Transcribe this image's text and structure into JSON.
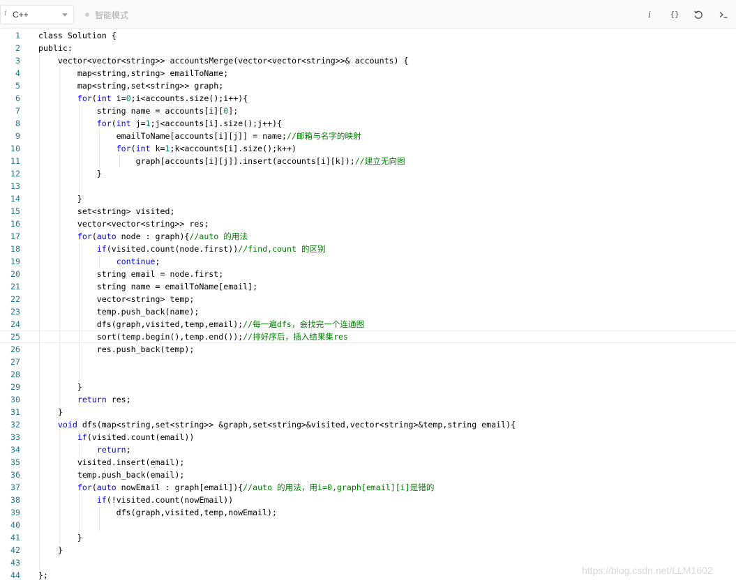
{
  "toolbar": {
    "language_icon": "i",
    "language": "C++",
    "smart_mode": "智能模式",
    "info_button": "i",
    "format_button": "{}",
    "reset_icon": "undo-icon",
    "console_icon": "terminal-icon"
  },
  "editor": {
    "current_line": 25,
    "colors": {
      "keyword": "#0000ff",
      "number": "#098658",
      "comment": "#008000",
      "line_number": "#237893",
      "text": "#000000"
    },
    "lines": [
      {
        "n": "1",
        "t": [
          [
            "class Solution {",
            ""
          ]
        ]
      },
      {
        "n": "2",
        "t": [
          [
            "public",
            ""
          ],
          [
            ":",
            ""
          ]
        ]
      },
      {
        "n": "3",
        "t": [
          [
            "    vector<vector<string>> accountsMerge(vector<vector<string>>& accounts) {",
            ""
          ]
        ]
      },
      {
        "n": "4",
        "t": [
          [
            "        map<string,string> emailToName;",
            ""
          ]
        ]
      },
      {
        "n": "5",
        "t": [
          [
            "        map<string,set<string>> graph;",
            ""
          ]
        ]
      },
      {
        "n": "6",
        "t": [
          [
            "        ",
            ""
          ],
          [
            "for",
            "k"
          ],
          [
            "(",
            ""
          ],
          [
            "int",
            "k"
          ],
          [
            " i=",
            ""
          ],
          [
            "0",
            "n"
          ],
          [
            ";i<accounts.size();i++){",
            ""
          ]
        ]
      },
      {
        "n": "7",
        "t": [
          [
            "            string name = accounts[i][",
            ""
          ],
          [
            "0",
            "n"
          ],
          [
            "];",
            ""
          ]
        ]
      },
      {
        "n": "8",
        "t": [
          [
            "            ",
            ""
          ],
          [
            "for",
            "k"
          ],
          [
            "(",
            ""
          ],
          [
            "int",
            "k"
          ],
          [
            " j=",
            ""
          ],
          [
            "1",
            "n"
          ],
          [
            ";j<accounts[i].size();j++){",
            ""
          ]
        ]
      },
      {
        "n": "9",
        "t": [
          [
            "                emailToName[accounts[i][j]] = name;",
            ""
          ],
          [
            "//邮箱与名字的映射",
            "c"
          ]
        ]
      },
      {
        "n": "10",
        "t": [
          [
            "                ",
            ""
          ],
          [
            "for",
            "k"
          ],
          [
            "(",
            ""
          ],
          [
            "int",
            "k"
          ],
          [
            " k=",
            ""
          ],
          [
            "1",
            "n"
          ],
          [
            ";k<accounts[i].size();k++)",
            ""
          ]
        ]
      },
      {
        "n": "11",
        "t": [
          [
            "                    graph[accounts[i][j]].insert(accounts[i][k]);",
            ""
          ],
          [
            "//建立无向图",
            "c"
          ]
        ]
      },
      {
        "n": "12",
        "t": [
          [
            "            }",
            ""
          ]
        ]
      },
      {
        "n": "13",
        "t": [
          [
            "",
            ""
          ]
        ]
      },
      {
        "n": "14",
        "t": [
          [
            "        }",
            ""
          ]
        ]
      },
      {
        "n": "15",
        "t": [
          [
            "        set<string> visited;",
            ""
          ]
        ]
      },
      {
        "n": "16",
        "t": [
          [
            "        vector<vector<string>> res;",
            ""
          ]
        ]
      },
      {
        "n": "17",
        "t": [
          [
            "        ",
            ""
          ],
          [
            "for",
            "k"
          ],
          [
            "(",
            ""
          ],
          [
            "auto",
            "k"
          ],
          [
            " node : graph){",
            ""
          ],
          [
            "//auto 的用法",
            "c"
          ]
        ]
      },
      {
        "n": "18",
        "t": [
          [
            "            ",
            ""
          ],
          [
            "if",
            "k"
          ],
          [
            "(visited.count(node.first))",
            ""
          ],
          [
            "//find,count 的区别",
            "c"
          ]
        ]
      },
      {
        "n": "19",
        "t": [
          [
            "                ",
            ""
          ],
          [
            "continue",
            "k"
          ],
          [
            ";",
            ""
          ]
        ]
      },
      {
        "n": "20",
        "t": [
          [
            "            string email = node.first;",
            ""
          ]
        ]
      },
      {
        "n": "21",
        "t": [
          [
            "            string name = emailToName[email];",
            ""
          ]
        ]
      },
      {
        "n": "22",
        "t": [
          [
            "            vector<string> temp;",
            ""
          ]
        ]
      },
      {
        "n": "23",
        "t": [
          [
            "            temp.push_back(name);",
            ""
          ]
        ]
      },
      {
        "n": "24",
        "t": [
          [
            "            dfs(graph,visited,temp,email);",
            ""
          ],
          [
            "//每一遍dfs，会找完一个连通图",
            "c"
          ]
        ]
      },
      {
        "n": "25",
        "t": [
          [
            "            sort(temp.begin(),temp.end());",
            ""
          ],
          [
            "//排好序后，插入结果集res",
            "c"
          ]
        ]
      },
      {
        "n": "26",
        "t": [
          [
            "            res.push_back(temp);",
            ""
          ]
        ]
      },
      {
        "n": "27",
        "t": [
          [
            "",
            ""
          ]
        ]
      },
      {
        "n": "28",
        "t": [
          [
            "",
            ""
          ]
        ]
      },
      {
        "n": "29",
        "t": [
          [
            "        }",
            ""
          ]
        ]
      },
      {
        "n": "30",
        "t": [
          [
            "        ",
            ""
          ],
          [
            "return",
            "k"
          ],
          [
            " res;",
            ""
          ]
        ]
      },
      {
        "n": "31",
        "t": [
          [
            "    }",
            ""
          ]
        ]
      },
      {
        "n": "32",
        "t": [
          [
            "    ",
            ""
          ],
          [
            "void",
            "k"
          ],
          [
            " dfs(map<string,set<string>> &graph,set<string>&visited,vector<string>&temp,string email){",
            ""
          ]
        ]
      },
      {
        "n": "33",
        "t": [
          [
            "        ",
            ""
          ],
          [
            "if",
            "k"
          ],
          [
            "(visited.count(email))",
            ""
          ]
        ]
      },
      {
        "n": "34",
        "t": [
          [
            "            ",
            ""
          ],
          [
            "return",
            "k"
          ],
          [
            ";",
            ""
          ]
        ]
      },
      {
        "n": "35",
        "t": [
          [
            "        visited.insert(email);",
            ""
          ]
        ]
      },
      {
        "n": "36",
        "t": [
          [
            "        temp.push_back(email);",
            ""
          ]
        ]
      },
      {
        "n": "37",
        "t": [
          [
            "        ",
            ""
          ],
          [
            "for",
            "k"
          ],
          [
            "(",
            ""
          ],
          [
            "auto",
            "k"
          ],
          [
            " nowEmail : graph[email]){",
            ""
          ],
          [
            "//auto 的用法，用i=0,graph[email][i]是错的",
            "c"
          ]
        ]
      },
      {
        "n": "38",
        "t": [
          [
            "            ",
            ""
          ],
          [
            "if",
            "k"
          ],
          [
            "(!visited.count(nowEmail))",
            ""
          ]
        ]
      },
      {
        "n": "39",
        "t": [
          [
            "                dfs(graph,visited,temp,nowEmail);",
            ""
          ]
        ]
      },
      {
        "n": "40",
        "t": [
          [
            "",
            ""
          ]
        ]
      },
      {
        "n": "41",
        "t": [
          [
            "        }",
            ""
          ]
        ]
      },
      {
        "n": "42",
        "t": [
          [
            "    }",
            ""
          ]
        ]
      },
      {
        "n": "43",
        "t": [
          [
            "",
            ""
          ]
        ]
      },
      {
        "n": "44",
        "t": [
          [
            "};",
            ""
          ]
        ]
      }
    ]
  },
  "watermark": "https://blog.csdn.net/LLM1602"
}
